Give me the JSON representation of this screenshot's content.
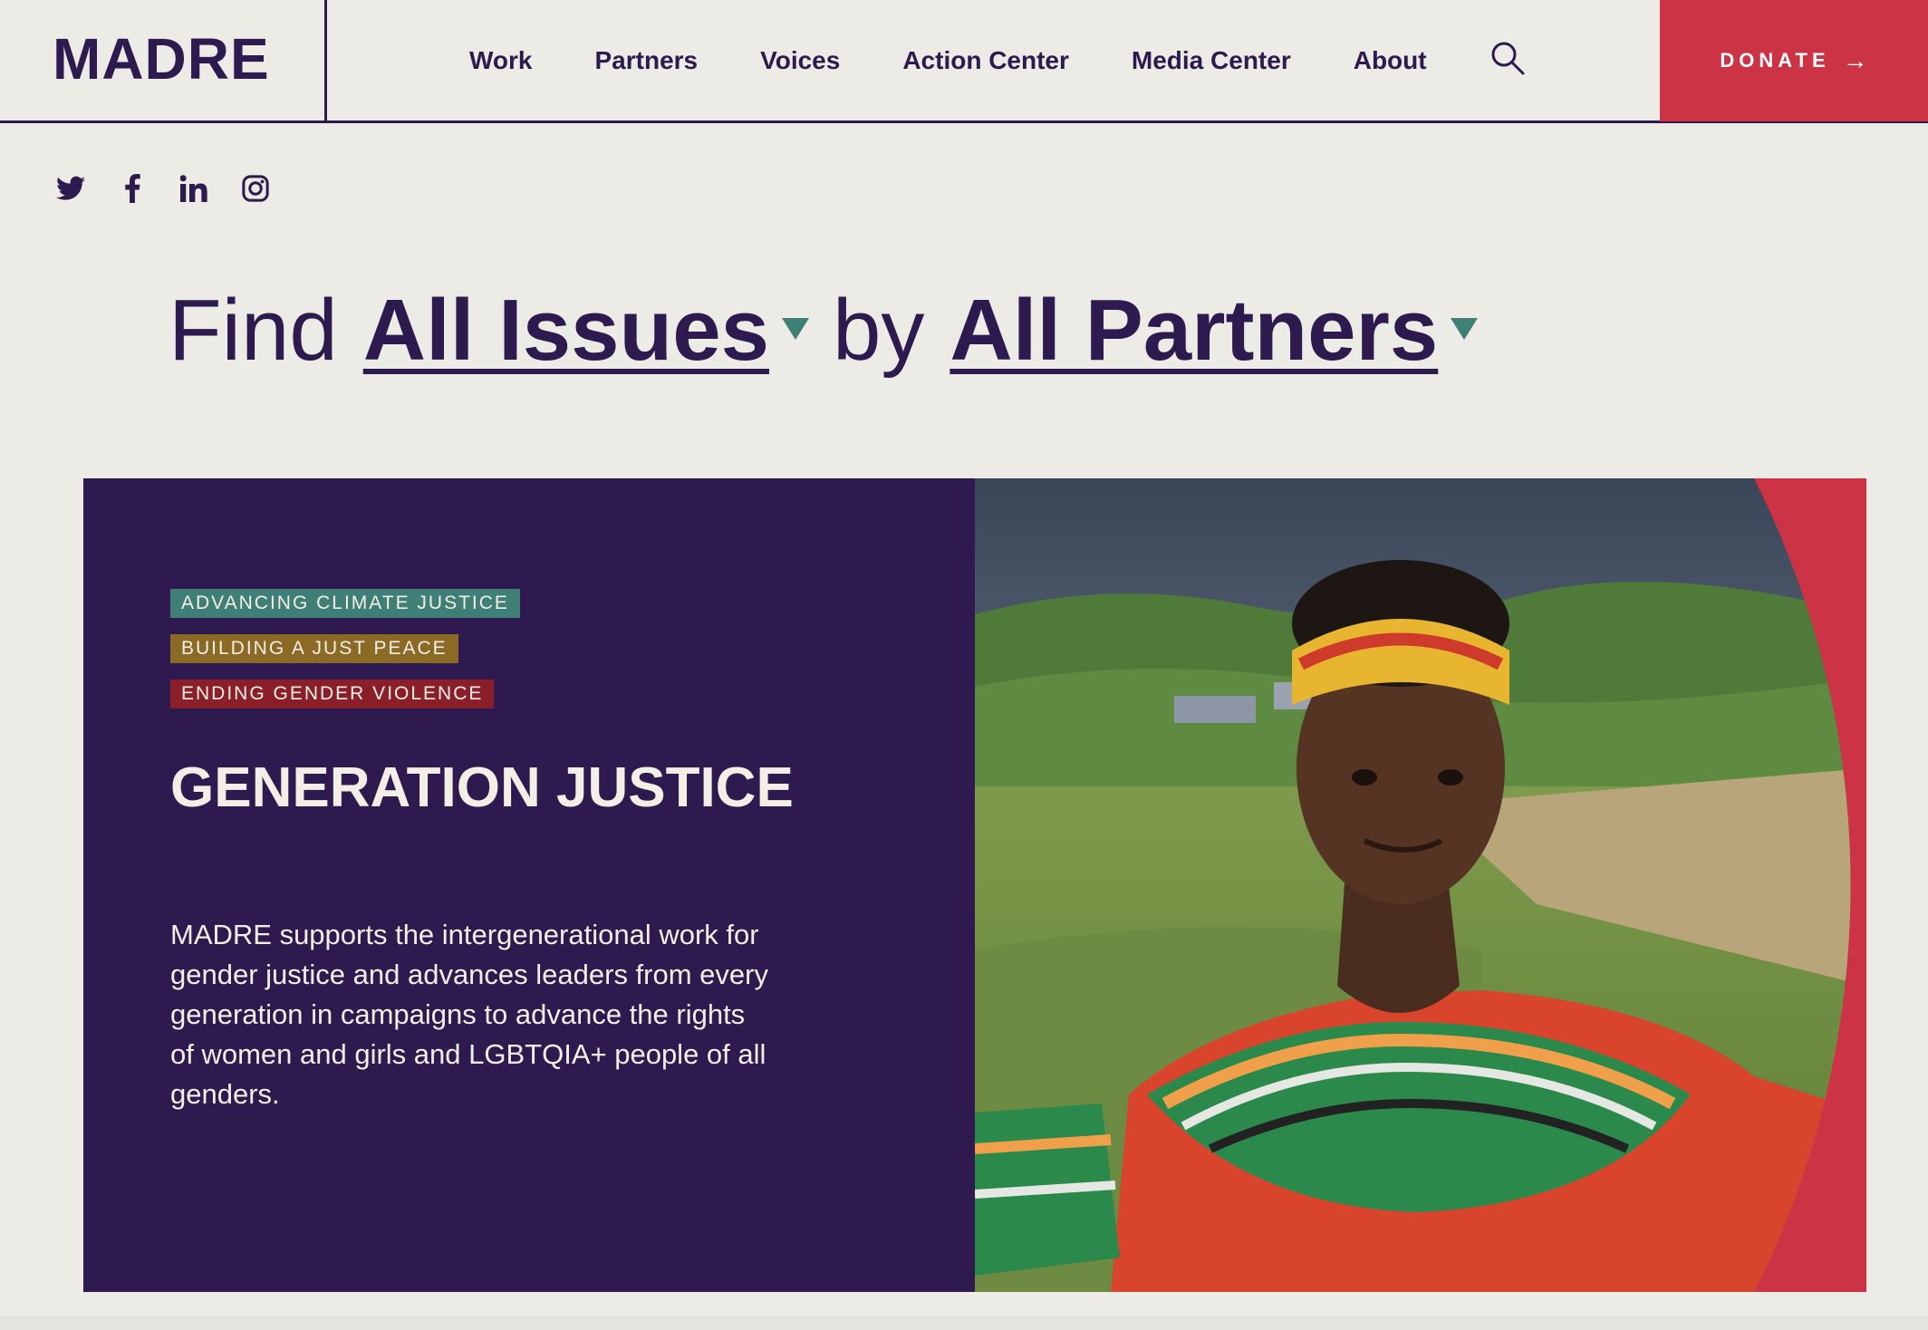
{
  "header": {
    "logo": "MADRE",
    "nav": [
      "Work",
      "Partners",
      "Voices",
      "Action Center",
      "Media Center",
      "About"
    ],
    "donate_label": "DONATE",
    "donate_arrow": "→"
  },
  "social": [
    "twitter-icon",
    "facebook-icon",
    "linkedin-icon",
    "instagram-icon"
  ],
  "headline": {
    "find": "Find",
    "issues_filter": "All Issues",
    "by": "by",
    "partners_filter": "All Partners"
  },
  "card": {
    "tags": [
      {
        "label": "ADVANCING CLIMATE JUSTICE",
        "color": "#3f7f76"
      },
      {
        "label": "BUILDING A JUST PEACE",
        "color": "#8b6a26"
      },
      {
        "label": "ENDING GENDER VIOLENCE",
        "color": "#8a1f2a"
      }
    ],
    "title": "GENERATION JUSTICE",
    "body": "MADRE supports the intergenerational work for gender justice and advances leaders from every generation in campaigns to advance the rights of women and girls and LGBTQIA+ people of all genders."
  },
  "colors": {
    "brand_purple": "#2d1a4f",
    "donate_red": "#cc3344",
    "caret_teal": "#3f7f76",
    "page_bg": "#ecebe6"
  }
}
